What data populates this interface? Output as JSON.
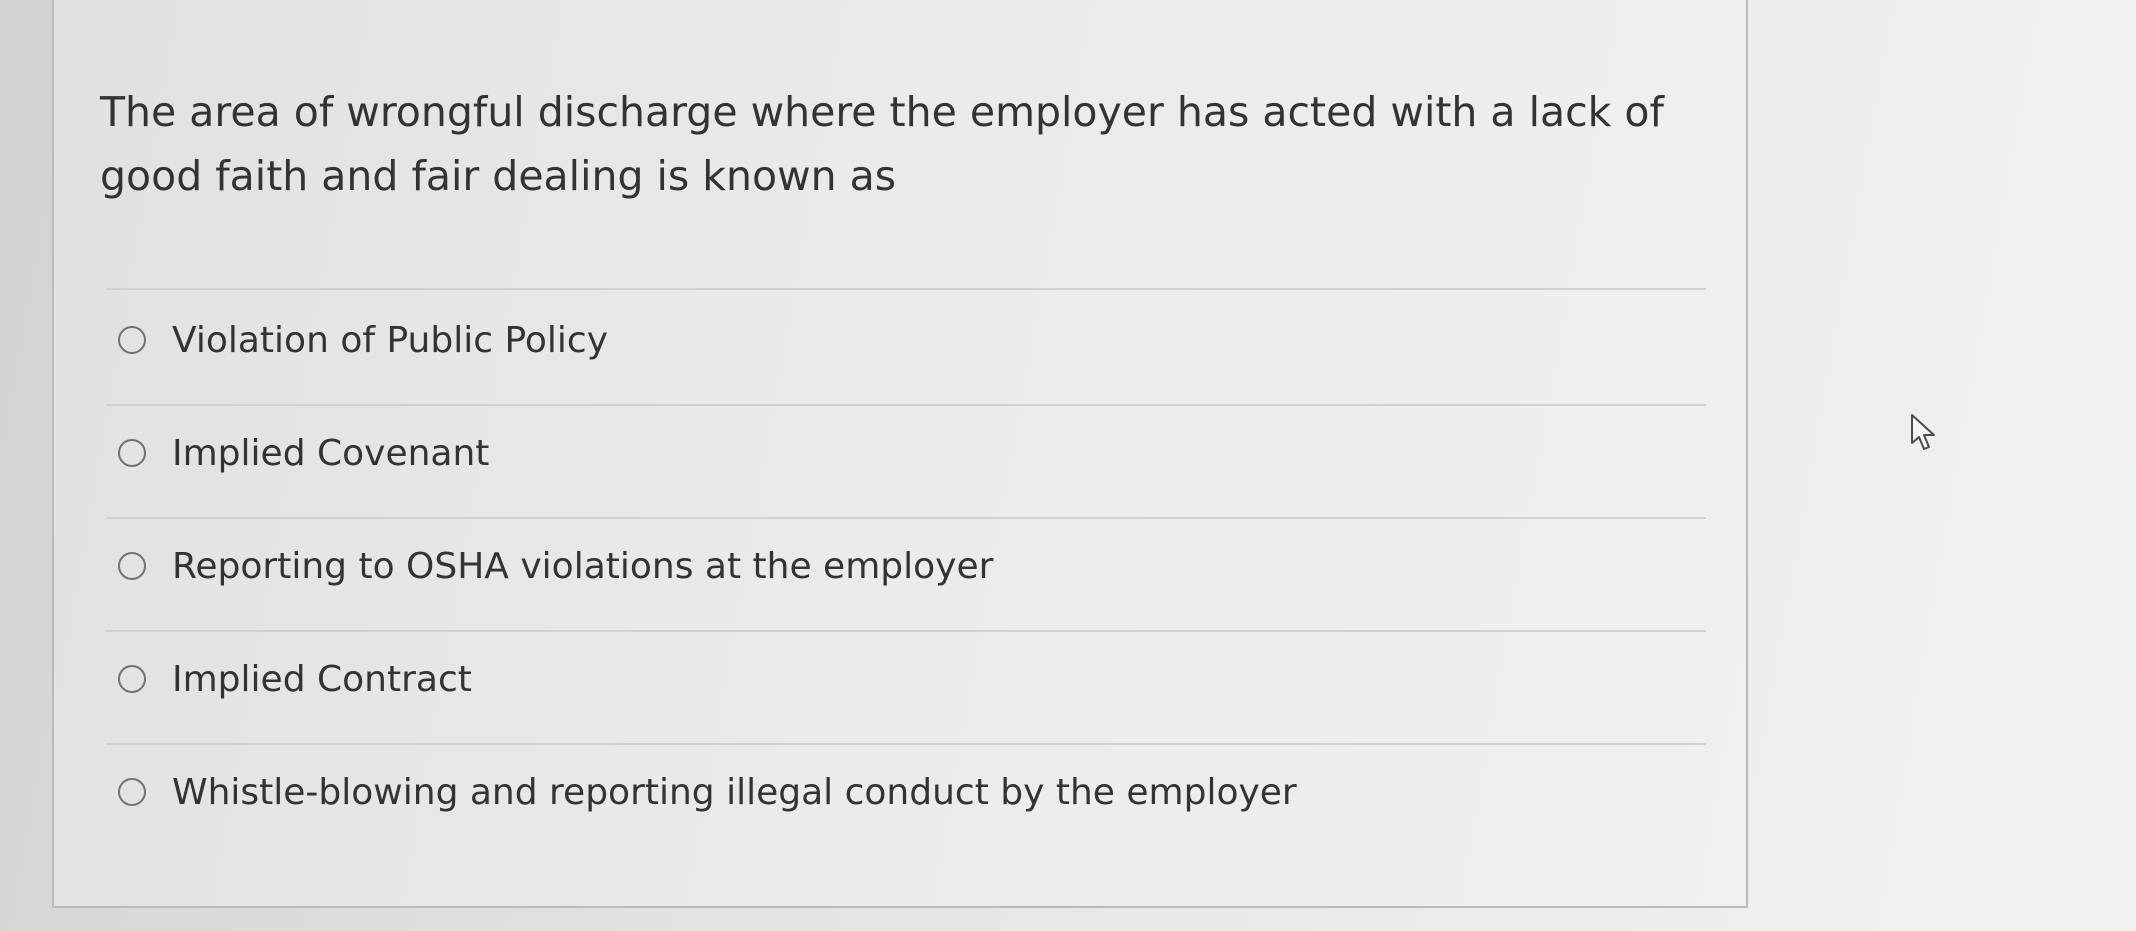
{
  "question": {
    "text": "The area of wrongful discharge where the employer has acted with a lack of good faith and fair dealing is known as"
  },
  "options": [
    {
      "label": "Violation of Public Policy",
      "selected": false
    },
    {
      "label": "Implied Covenant",
      "selected": false
    },
    {
      "label": "Reporting to OSHA violations at the employer",
      "selected": false
    },
    {
      "label": "Implied Contract",
      "selected": false
    },
    {
      "label": "Whistle-blowing and reporting illegal conduct by the employer",
      "selected": false
    }
  ],
  "cursor": {
    "icon": "pointer-cursor-icon"
  }
}
